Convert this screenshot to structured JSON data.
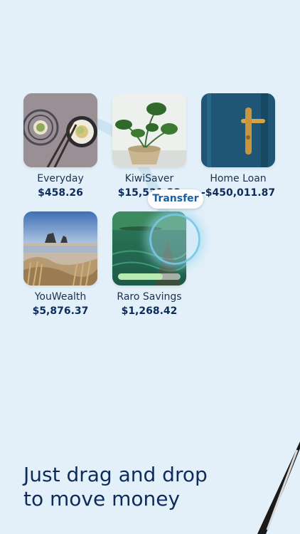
{
  "accounts": [
    {
      "name": "Everyday",
      "balance": "$458.26",
      "image": "sushi-photo"
    },
    {
      "name": "KiwiSaver",
      "balance": "$15,531.33",
      "image": "plant-photo"
    },
    {
      "name": "Home Loan",
      "balance": "-$450,011.87",
      "image": "door-photo"
    },
    {
      "name": "YouWealth",
      "balance": "$5,876.37",
      "image": "beach-photo"
    },
    {
      "name": "Raro Savings",
      "balance": "$1,268.42",
      "image": "island-photo",
      "progress": 0.72
    }
  ],
  "transfer": {
    "label": "Transfer"
  },
  "headline": {
    "line1": "Just drag and drop",
    "line2": "to move money"
  },
  "colors": {
    "background": "#e3f0f9",
    "text": "#0d2c5b",
    "accent": "#1a5fa0",
    "progress": "#b7eab0"
  }
}
